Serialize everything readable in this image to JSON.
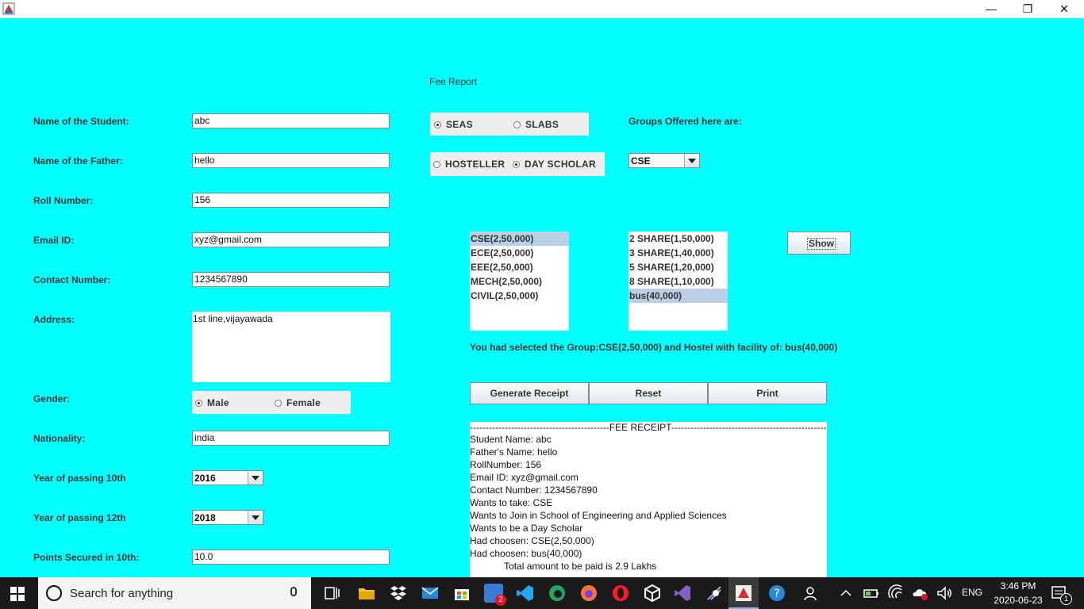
{
  "window": {
    "minimize": "—",
    "restore": "❐",
    "close": "✕"
  },
  "report_title": "Fee Report",
  "form": {
    "student_name_label": "Name of the Student:",
    "student_name_value": "abc",
    "father_name_label": "Name of the Father:",
    "father_name_value": "hello",
    "roll_label": "Roll Number:",
    "roll_value": "156",
    "email_label": "Email ID:",
    "email_value": "xyz@gmail.com",
    "contact_label": "Contact Number:",
    "contact_value": "1234567890",
    "address_label": "Address:",
    "address_value": "1st line,vijayawada",
    "gender_label": "Gender:",
    "gender_male": "Male",
    "gender_female": "Female",
    "nationality_label": "Nationality:",
    "nationality_value": "india",
    "year10_label": "Year of passing 10th",
    "year10_value": "2016",
    "year12_label": "Year of passing 12th",
    "year12_value": "2018",
    "points10_label": "Points Secured in 10th:",
    "points10_value": "10.0"
  },
  "school": {
    "seas": "SEAS",
    "slabs": "SLABS",
    "hosteller": "HOSTELLER",
    "day_scholar": "DAY SCHOLAR",
    "groups_label": "Groups Offered here are:",
    "group_combo_value": "CSE"
  },
  "groups_list": [
    "CSE(2,50,000)",
    "ECE(2,50,000)",
    "EEE(2,50,000)",
    "MECH(2,50,000)",
    "CIVIL(2,50,000)"
  ],
  "hostel_list": [
    "2 SHARE(1,50,000)",
    "3 SHARE(1,40,000)",
    "5 SHARE(1,20,000)",
    "8 SHARE(1,10,000)",
    "bus(40,000)"
  ],
  "show_button": "Show",
  "selection_text": "You had selected the Group:CSE(2,50,000) and Hostel with facility of: bus(40,000)",
  "buttons": {
    "generate": "Generate Receipt",
    "reset": "Reset",
    "print": "Print"
  },
  "receipt": {
    "header": "--------------------------------------------FEE RECEIPT--------------------------------------------------------",
    "lines": [
      "Student Name: abc",
      "Father's Name: hello",
      "RollNumber: 156",
      "Email ID: xyz@gmail.com",
      "Contact Number: 1234567890",
      "Wants to take: CSE",
      "Wants to Join in School of Engineering and Applied Sciences",
      "Wants to be a Day Scholar",
      "Had choosen: CSE(2,50,000)",
      "Had choosen: bus(40,000)",
      "             Total amount to be paid is 2.9 Lakhs"
    ]
  },
  "taskbar": {
    "search_placeholder": "Search for anything",
    "mail_badge": "2",
    "language": "ENG",
    "time": "3:46 PM",
    "date": "2020-06-23",
    "notification_count": "1"
  }
}
